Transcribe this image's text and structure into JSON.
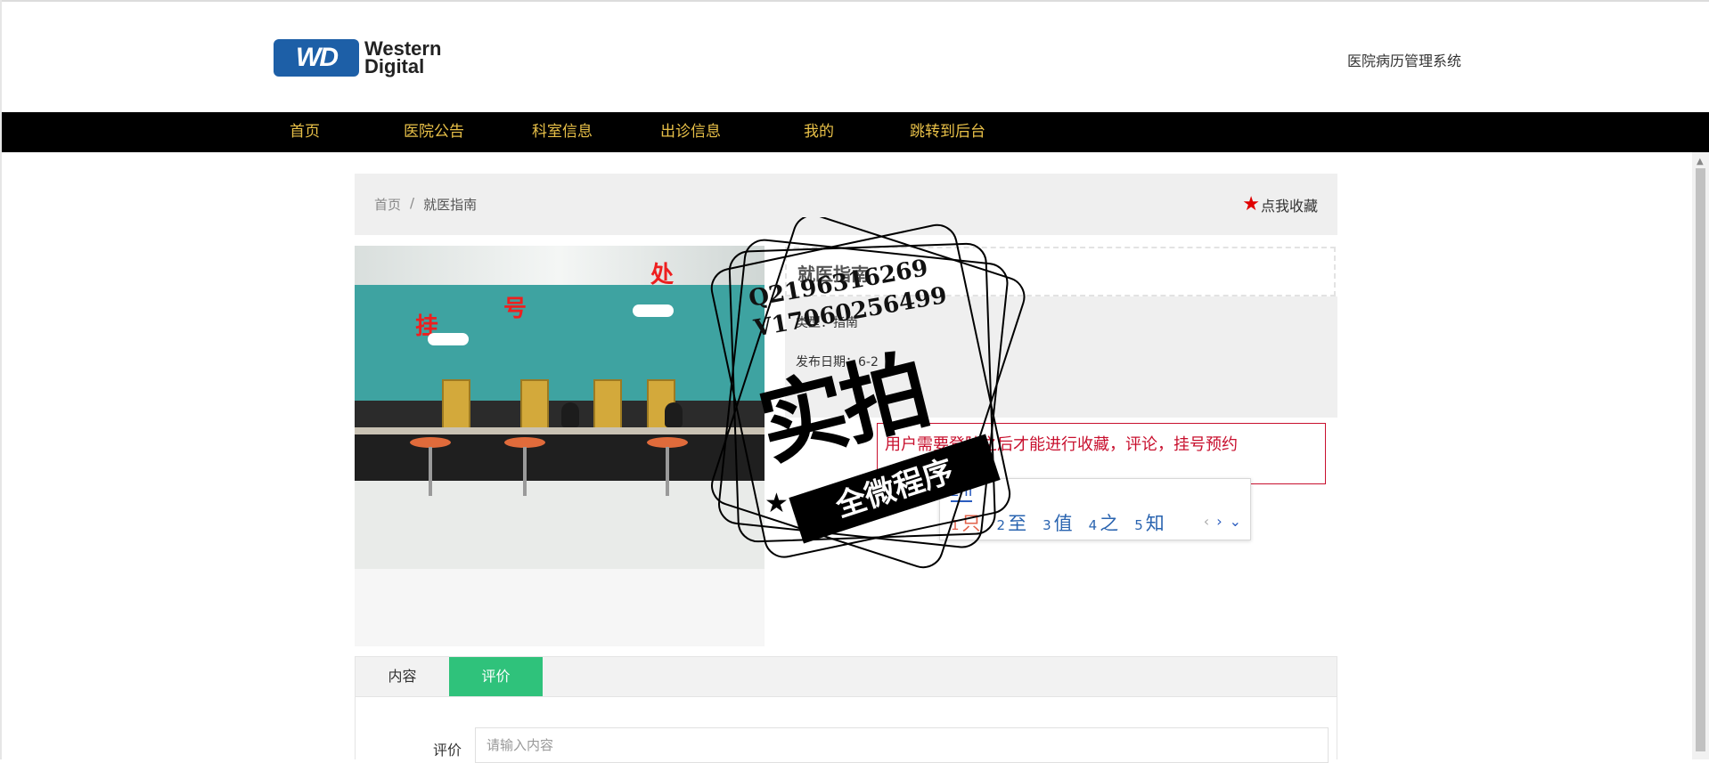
{
  "header": {
    "logo_mark": "WD",
    "logo_line1": "Western",
    "logo_line2": "Digital",
    "system_title": "医院病历管理系统"
  },
  "nav": {
    "items": [
      {
        "label": "首页"
      },
      {
        "label": "医院公告"
      },
      {
        "label": "科室信息"
      },
      {
        "label": "出诊信息"
      },
      {
        "label": "我的"
      },
      {
        "label": "跳转到后台"
      }
    ]
  },
  "breadcrumb": {
    "home": "首页",
    "separator": "/",
    "current": "就医指南"
  },
  "favorite": {
    "icon": "star-icon",
    "label": "点我收藏",
    "color": "#e00000"
  },
  "detail": {
    "title": "就医指南",
    "type_label": "类型：",
    "type_value": "指南",
    "date_label": "发布日期：",
    "date_value": "6-2"
  },
  "notice": {
    "text": "用户需要登陆之后才能进行收藏，评论，挂号预约",
    "color": "#c8102e"
  },
  "ime": {
    "input": "zhi",
    "candidates": [
      {
        "num": "1",
        "text": "只"
      },
      {
        "num": "2",
        "text": "至"
      },
      {
        "num": "3",
        "text": "值"
      },
      {
        "num": "4",
        "text": "之"
      },
      {
        "num": "5",
        "text": "知"
      }
    ],
    "prev": "‹",
    "next": "›",
    "expand": "⌄"
  },
  "photo": {
    "sign_chars": [
      "挂",
      "号",
      "处"
    ]
  },
  "tabs": {
    "items": [
      {
        "label": "内容",
        "active": false
      },
      {
        "label": "评价",
        "active": true
      }
    ],
    "active_color": "#2fc27b"
  },
  "review": {
    "label": "评价",
    "placeholder": "请输入内容",
    "value": ""
  },
  "watermark": {
    "contact_line1": "Q2196316269",
    "contact_line2": "V17060256499",
    "big_text": "实拍",
    "banner_text": "全微程序"
  },
  "scrollbar": {
    "up_arrow": "▲"
  }
}
